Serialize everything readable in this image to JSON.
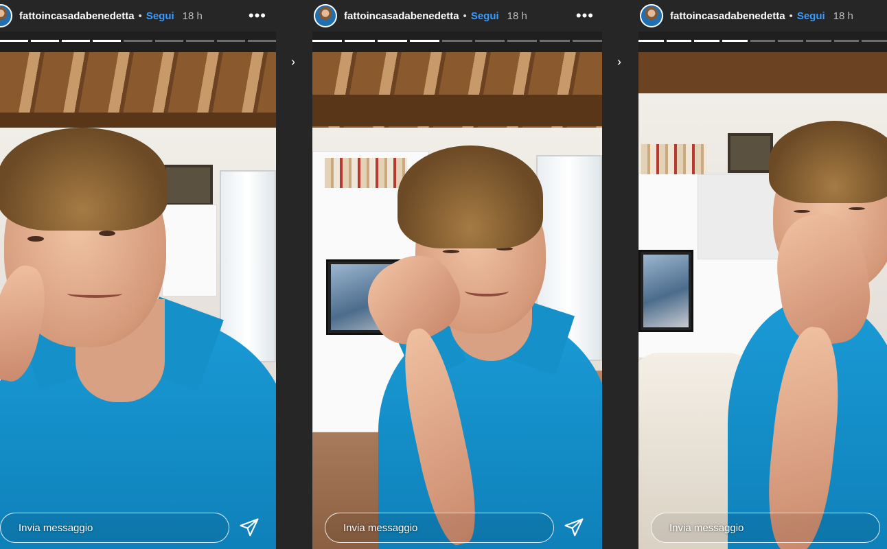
{
  "stories": [
    {
      "username": "fattoincasadabenedetta",
      "separator": "•",
      "follow_label": "Segui",
      "time": "18 h",
      "more_label": "•••",
      "reply_placeholder": "Invia messaggio",
      "progress_done": 4,
      "progress_total": 9
    },
    {
      "username": "fattoincasadabenedetta",
      "separator": "•",
      "follow_label": "Segui",
      "time": "18 h",
      "more_label": "•••",
      "reply_placeholder": "Invia messaggio",
      "progress_done": 4,
      "progress_total": 9
    },
    {
      "username": "fattoincasadabenedetta",
      "separator": "•",
      "follow_label": "Segui",
      "time": "18 h",
      "more_label": "",
      "reply_placeholder": "Invia messaggio",
      "progress_done": 4,
      "progress_total": 9
    }
  ],
  "nav": {
    "next_label": "›"
  },
  "colors": {
    "background": "#262626",
    "follow": "#3a9bff",
    "shirt": "#1a9bd6"
  },
  "icons": {
    "send": "paper-plane-icon",
    "more": "more-icon",
    "avatar": "profile-avatar",
    "next": "chevron-right-icon"
  }
}
